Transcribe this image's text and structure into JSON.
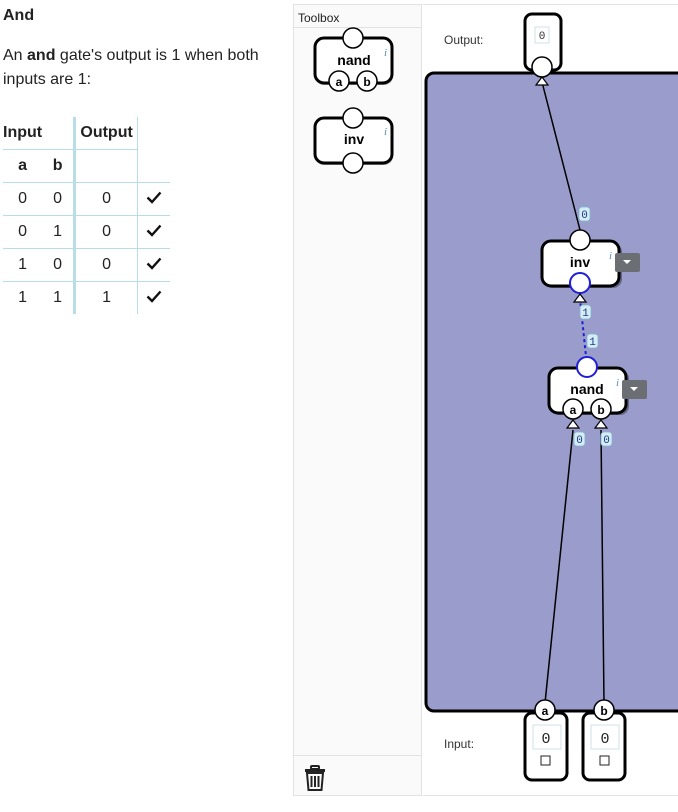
{
  "level": {
    "title": "And",
    "description_before": "An ",
    "description_bold": "and",
    "description_after": " gate's output is 1 when both inputs are 1:"
  },
  "truth_table": {
    "group_input": "Input",
    "group_output": "Output",
    "col_a": "a",
    "col_b": "b",
    "rows": [
      {
        "a": "0",
        "b": "0",
        "out": "0"
      },
      {
        "a": "0",
        "b": "1",
        "out": "0"
      },
      {
        "a": "1",
        "b": "0",
        "out": "0"
      },
      {
        "a": "1",
        "b": "1",
        "out": "1"
      }
    ]
  },
  "toolbox": {
    "title": "Toolbox",
    "items": [
      {
        "label": "nand",
        "pins": [
          "a",
          "b"
        ]
      },
      {
        "label": "inv"
      }
    ],
    "trash_icon": "trash-icon"
  },
  "canvas": {
    "output_label": "Output:",
    "input_label": "Input:",
    "output_value": "0",
    "input_a_name": "a",
    "input_b_name": "b",
    "input_a_value": "0",
    "input_b_value": "0",
    "inv_label": "inv",
    "nand_label": "nand",
    "nand_pin_a": "a",
    "nand_pin_b": "b",
    "wire_inv_to_out": "0",
    "wire_nand_to_inv_top": "1",
    "wire_nand_to_inv_bottom": "1",
    "wire_a_to_nand": "0",
    "wire_b_to_nand": "0",
    "info_glyph": "i",
    "colors": {
      "circuit_bg": "#9a9ccb",
      "active_wire": "#1f1fd6",
      "value_badge_bg": "#d6ecf5"
    }
  }
}
